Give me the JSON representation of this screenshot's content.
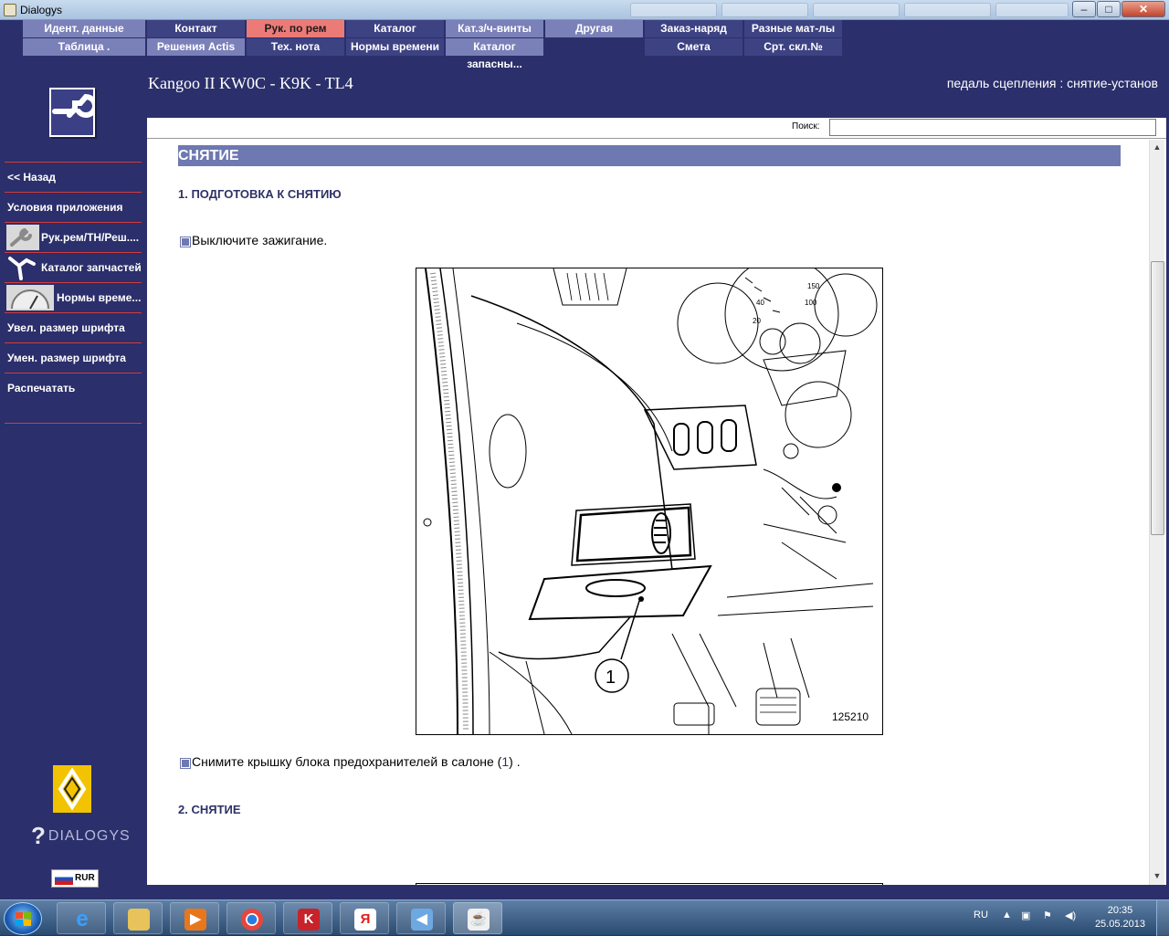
{
  "window": {
    "title": "Dialogys",
    "min": "–",
    "max": "□",
    "close": "✕"
  },
  "menu": {
    "row1": [
      "Идент. данные",
      "Контакт",
      "Рук. по рем",
      "Каталог запчастей",
      "Кат.з/ч-винты",
      "Другая",
      "Заказ-наряд",
      "Разные мат-лы"
    ],
    "row2": [
      "Таблица .",
      "Решения Actis",
      "Тех. нота",
      "Нормы времени",
      "Каталог запасны...",
      "Смета",
      "Срт. скл.№"
    ]
  },
  "header": {
    "vehicle": "Kangoo II KW0C - K9K - TL4",
    "operation": "педаль сцепления : снятие-установ"
  },
  "sidebar": {
    "items": [
      "<< Назад",
      "Условия приложения",
      "Рук.рем/ТН/Реш....",
      "Каталог запчастей",
      "Нормы време...",
      "Увел. размер шрифта",
      "Умен. размер шрифта",
      "Распечатать"
    ],
    "brand": "DIALOGYS",
    "currency": "RUR"
  },
  "search": {
    "label": "Поиск:",
    "value": ""
  },
  "doc": {
    "section": "СНЯТИЕ",
    "step1": "1. ПОДГОТОВКА К СНЯТИЮ",
    "bullet1": "Выключите зажигание.",
    "figure_label": "125210",
    "callout": "1",
    "bullet2_text": "Снимите крышку блока предохранителей в салоне",
    "bullet2_open": " (",
    "bullet2_num": "1",
    "bullet2_close": ") .",
    "step2": "2. СНЯТИЕ"
  },
  "taskbar": {
    "lang": "RU",
    "time": "20:35",
    "date": "25.05.2013",
    "yandex": "Я",
    "kaspersky": "K"
  },
  "colors": {
    "bg": "#2b2f6b",
    "menu_light": "#7a80b8",
    "menu_dark": "#3d4283",
    "menu_active": "#ec7b78",
    "section": "#6e78b1",
    "divider": "#d23b3b"
  }
}
